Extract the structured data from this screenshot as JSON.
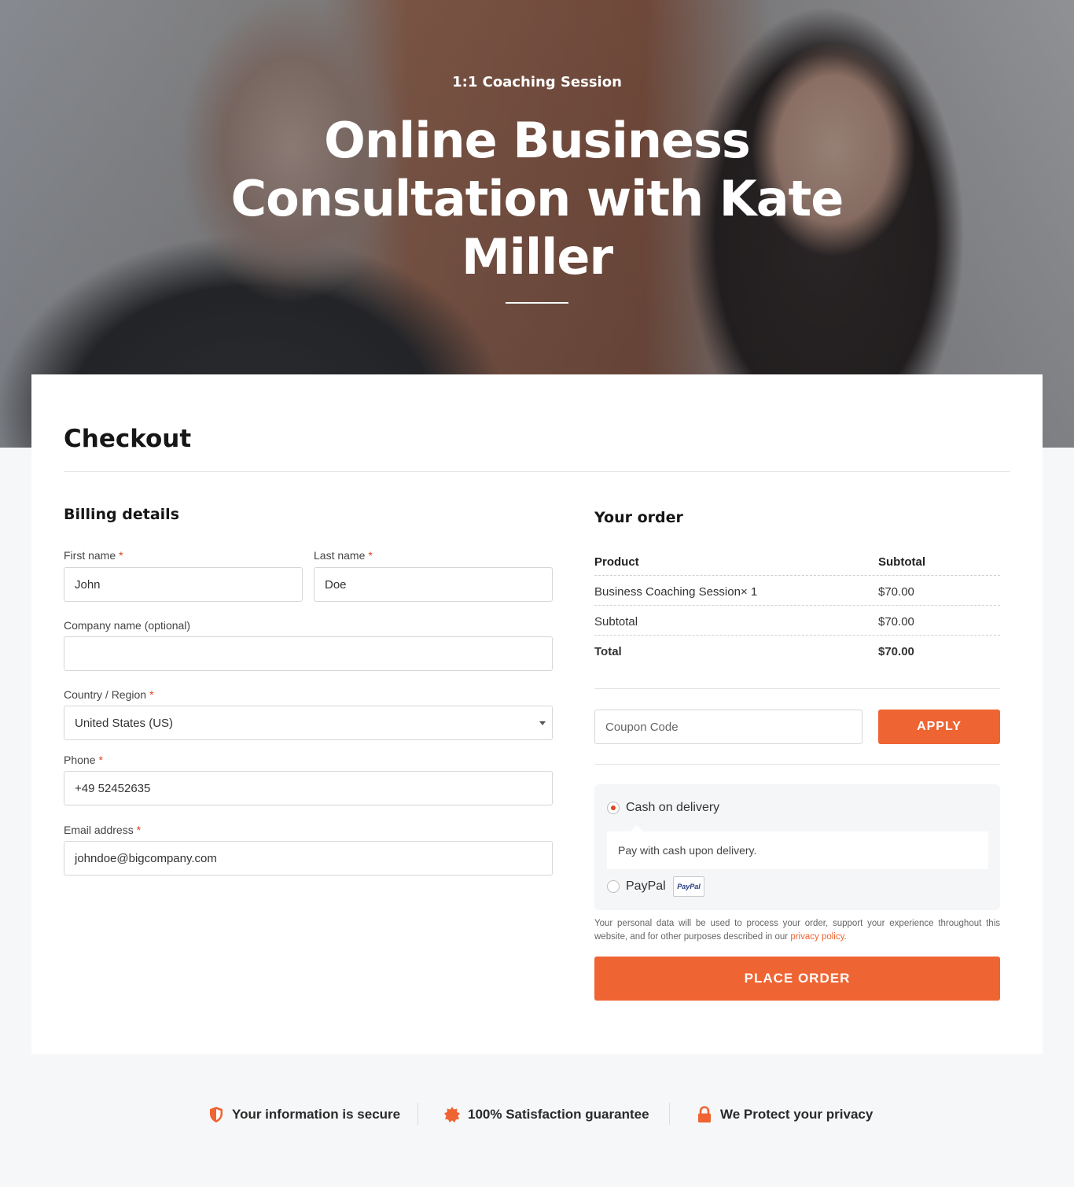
{
  "hero": {
    "eyebrow": "1:1 Coaching Session",
    "title": "Online Business Consultation with Kate Miller"
  },
  "checkout": {
    "title": "Checkout"
  },
  "billing": {
    "heading": "Billing details",
    "first_name": {
      "label": "First name",
      "required": "*",
      "value": "John"
    },
    "last_name": {
      "label": "Last name",
      "required": "*",
      "value": "Doe"
    },
    "company": {
      "label": "Company name (optional)",
      "value": ""
    },
    "country": {
      "label": "Country / Region",
      "required": "*",
      "value": "United States (US)"
    },
    "phone": {
      "label": "Phone",
      "required": "*",
      "value": "+49 52452635"
    },
    "email": {
      "label": "Email address",
      "required": "*",
      "value": "johndoe@bigcompany.com"
    }
  },
  "order": {
    "heading": "Your order",
    "columns": [
      "Product",
      "Subtotal"
    ],
    "rows": [
      {
        "product": "Business Coaching Session× 1",
        "subtotal": "$70.00"
      },
      {
        "product": "Subtotal",
        "subtotal": "$70.00"
      },
      {
        "product": "Total",
        "subtotal": "$70.00"
      }
    ],
    "coupon_placeholder": "Coupon Code",
    "apply_label": "APPLY",
    "payment": {
      "options": [
        {
          "label": "Cash on delivery",
          "selected": true,
          "description": "Pay with cash upon delivery."
        },
        {
          "label": "PayPal",
          "selected": false,
          "badge": "PayPal"
        }
      ]
    },
    "privacy_text": "Your personal data will be used to process your order, support your experience throughout this website, and for other purposes described in our",
    "privacy_link": "privacy policy",
    "privacy_end": ".",
    "place_order_label": "PLACE ORDER"
  },
  "trust": [
    {
      "icon": "shield-icon",
      "label": "Your information is secure"
    },
    {
      "icon": "badge-icon",
      "label": "100% Satisfaction guarantee"
    },
    {
      "icon": "lock-icon",
      "label": "We Protect your privacy"
    }
  ],
  "colors": {
    "accent": "#ef6433",
    "required": "#e2401c"
  }
}
